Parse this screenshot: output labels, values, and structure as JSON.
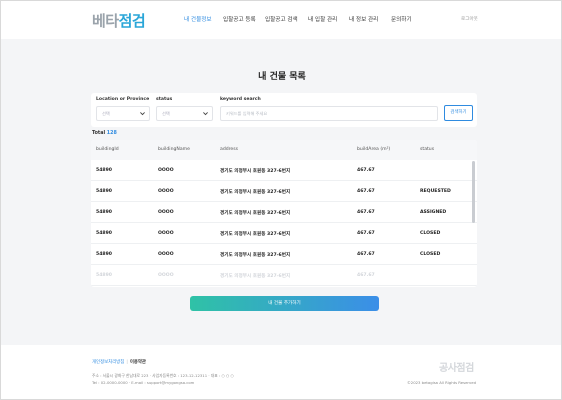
{
  "header": {
    "logo_part1": "베타",
    "logo_part2": "점검",
    "nav": [
      {
        "label": "내 건물정보",
        "active": true
      },
      {
        "label": "입찰공고 등록",
        "active": false
      },
      {
        "label": "입찰공고 검색",
        "active": false
      },
      {
        "label": "내 입찰 관리",
        "active": false
      },
      {
        "label": "내 정보 관리",
        "active": false
      },
      {
        "label": "문의하기",
        "active": false
      }
    ],
    "logout": "로그아웃"
  },
  "page": {
    "title": "내 건물 목록"
  },
  "filters": {
    "location_label": "Location or Province",
    "location_value": "선택",
    "status_label": "status",
    "status_value": "선택",
    "keyword_label": "keyword search",
    "keyword_placeholder": "키워드를 입력해 주세요",
    "search_button": "검색하기"
  },
  "total": {
    "label": "Total",
    "count": "128"
  },
  "table": {
    "columns": [
      "buildingId",
      "buildingName",
      "address",
      "buildArea (m²)",
      "status"
    ],
    "rows": [
      [
        "54890",
        "OOOO",
        "경기도 의정부시 호원동 327-6번지",
        "467.67",
        ""
      ],
      [
        "54890",
        "OOOO",
        "경기도 의정부시 호원동 327-6번지",
        "467.67",
        "REQUESTED"
      ],
      [
        "54890",
        "OOOO",
        "경기도 의정부시 호원동 327-6번지",
        "467.67",
        "ASSIGNED"
      ],
      [
        "54890",
        "OOOO",
        "경기도 의정부시 호원동 327-6번지",
        "467.67",
        "CLOSED"
      ],
      [
        "54890",
        "OOOO",
        "경기도 의정부시 호원동 327-6번지",
        "467.67",
        "CLOSED"
      ],
      [
        "54890",
        "OOOO",
        "경기도 의정부시 호원동 327-6번지",
        "467.67",
        ""
      ]
    ]
  },
  "more_button": "내 건물 추가하기",
  "footer": {
    "privacy": "개인정보처리방침",
    "terms": "이용약관",
    "info_line1": "주소 : 서울시 광화구 한남대로 223 · 사업자등록번호 : 123-12-12311 · 대표 : ○ ○ ○",
    "info_line2": "Tel : 02-0000-0000 · E-mail : support@mygongsa.com",
    "brand": "공사점검",
    "copyright": "©2023 betagisa All Rights Reserved"
  },
  "colors": {
    "accent": "#2f8be0",
    "gradient_start": "#2fc2a6",
    "gradient_end": "#3b8ee8"
  }
}
